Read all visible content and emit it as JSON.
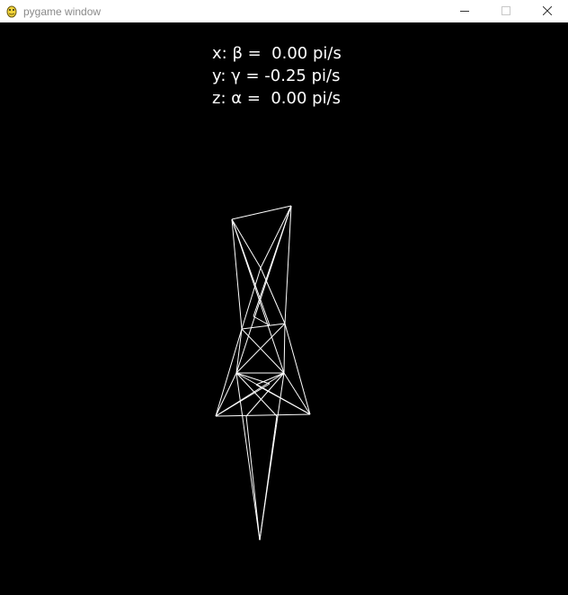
{
  "window": {
    "title": "pygame window",
    "controls": {
      "minimize": "minimize-icon",
      "maximize": "maximize-icon",
      "close": "close-icon"
    }
  },
  "readouts": [
    "x: β =  0.00 pi/s",
    "y: γ = -0.25 pi/s",
    "z: α =  0.00 pi/s"
  ],
  "colors": {
    "background": "#000000",
    "wireframe": "#ffffff",
    "text": "#ffffff"
  }
}
